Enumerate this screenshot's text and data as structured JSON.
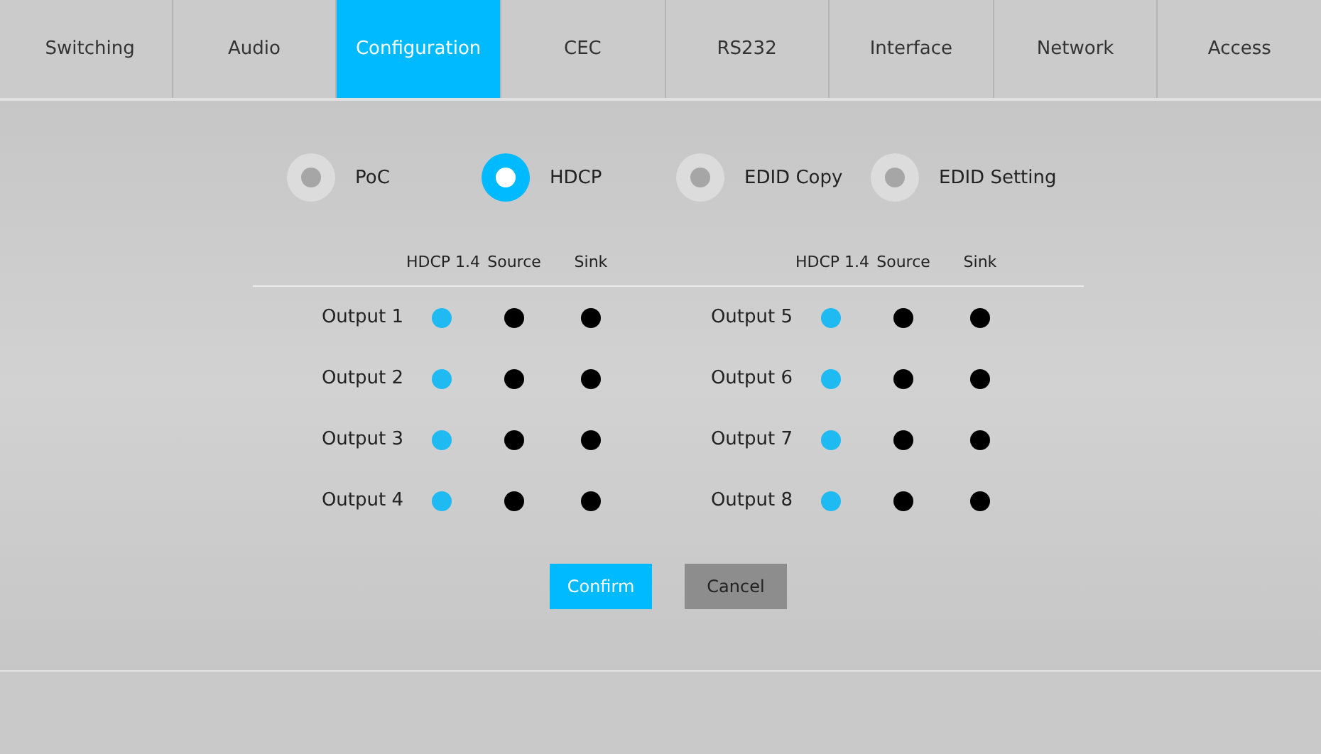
{
  "tabs": [
    {
      "label": "Switching",
      "selected": false
    },
    {
      "label": "Audio",
      "selected": false
    },
    {
      "label": "Configuration",
      "selected": true
    },
    {
      "label": "CEC",
      "selected": false
    },
    {
      "label": "RS232",
      "selected": false
    },
    {
      "label": "Interface",
      "selected": false
    },
    {
      "label": "Network",
      "selected": false
    },
    {
      "label": "Access",
      "selected": false
    }
  ],
  "modes": [
    {
      "label": "PoC",
      "selected": false
    },
    {
      "label": "HDCP",
      "selected": true
    },
    {
      "label": "EDID Copy",
      "selected": false
    },
    {
      "label": "EDID Setting",
      "selected": false
    }
  ],
  "groups": [
    {
      "columns": [
        "HDCP 1.4",
        "Source",
        "Sink"
      ],
      "outputs": [
        {
          "name": "Output 1",
          "options": [
            {
              "selected": true
            },
            {
              "selected": false
            },
            {
              "selected": false
            }
          ]
        },
        {
          "name": "Output 2",
          "options": [
            {
              "selected": true
            },
            {
              "selected": false
            },
            {
              "selected": false
            }
          ]
        },
        {
          "name": "Output 3",
          "options": [
            {
              "selected": true
            },
            {
              "selected": false
            },
            {
              "selected": false
            }
          ]
        },
        {
          "name": "Output 4",
          "options": [
            {
              "selected": true
            },
            {
              "selected": false
            },
            {
              "selected": false
            }
          ]
        }
      ]
    },
    {
      "columns": [
        "HDCP 1.4",
        "Source",
        "Sink"
      ],
      "outputs": [
        {
          "name": "Output 5",
          "options": [
            {
              "selected": true
            },
            {
              "selected": false
            },
            {
              "selected": false
            }
          ]
        },
        {
          "name": "Output 6",
          "options": [
            {
              "selected": true
            },
            {
              "selected": false
            },
            {
              "selected": false
            }
          ]
        },
        {
          "name": "Output 7",
          "options": [
            {
              "selected": true
            },
            {
              "selected": false
            },
            {
              "selected": false
            }
          ]
        },
        {
          "name": "Output 8",
          "options": [
            {
              "selected": true
            },
            {
              "selected": false
            },
            {
              "selected": false
            }
          ]
        }
      ]
    }
  ],
  "buttons": [
    {
      "label": "Confirm",
      "kind": "primary"
    },
    {
      "label": "Cancel",
      "kind": "secondary"
    }
  ]
}
